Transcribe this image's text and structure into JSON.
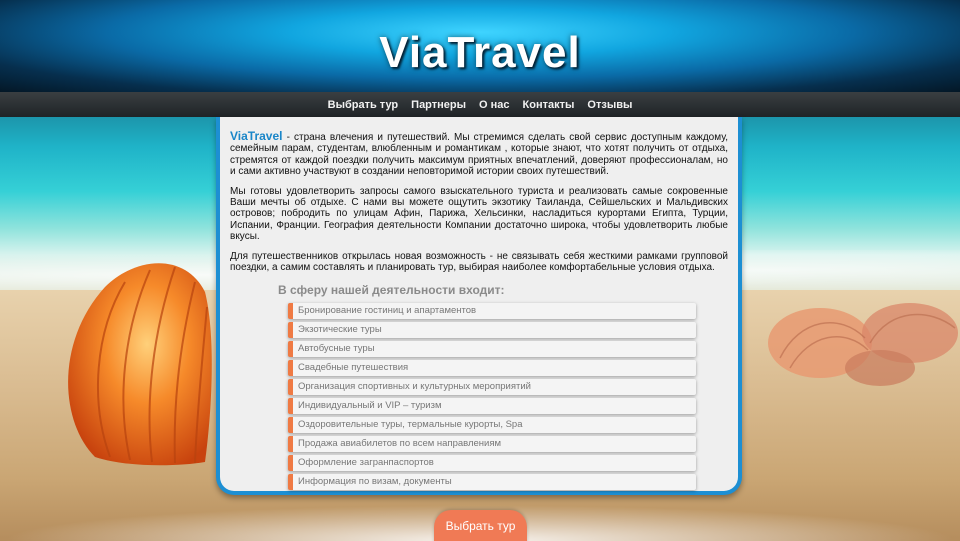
{
  "header": {
    "logo": "ViaTravel"
  },
  "nav": {
    "items": [
      {
        "label": "Выбрать тур"
      },
      {
        "label": "Партнеры"
      },
      {
        "label": "О нас"
      },
      {
        "label": "Контакты"
      },
      {
        "label": "Отзывы"
      }
    ]
  },
  "content": {
    "brand": "ViaTravel",
    "intro_rest": " - страна влечения и путешествий. Мы стремимся сделать свой сервис доступным каждому, семейным парам, студентам, влюбленным и романтикам , которые знают, что хотят получить от отдыха, стремятся от каждой поездки получить максимум приятных впечатлений, доверяют профессионалам, но и сами активно участвуют в создании неповторимой истории своих путешествий.",
    "para2": "Мы готовы удовлетворить запросы самого взыскательного туриста и реализовать самые сокровенные Ваши мечты об отдыхе. С нами вы можете ощутить экзотику Таиланда, Сейшельских и Мальдивских островов; побродить по улицам Афин, Парижа, Хельсинки, насладиться курортами Египта, Турции, Испании, Франции. География деятельности Компании достаточно широка, чтобы удовлетворить любые вкусы.",
    "para3": "Для путешественников открылась новая возможность - не связывать себя жесткими рамками групповой поездки, а самим составлять и планировать тур, выбирая наиболее комфортабельные условия отдыха.",
    "scope_title": "В сферу нашей деятельности входит:",
    "services": [
      "Бронирование гостиниц и апартаментов",
      "Экзотические туры",
      "Автобусные туры",
      "Свадебные путешествия",
      "Организация спортивных и культурных мероприятий",
      "Индивидуальный и VIP – туризм",
      "Оздоровительные туры, термальные курорты, Spa",
      "Продажа авиабилетов по всем направлениям",
      "Оформление загранпаспортов",
      "Информация по визам, документы"
    ]
  },
  "cta": {
    "label": "Выбрать тур"
  },
  "colors": {
    "accent_blue": "#1d8fd3",
    "brand_blue": "#1a86c8",
    "accent_orange": "#ef7a44",
    "nav_bg": "#2b3033"
  }
}
